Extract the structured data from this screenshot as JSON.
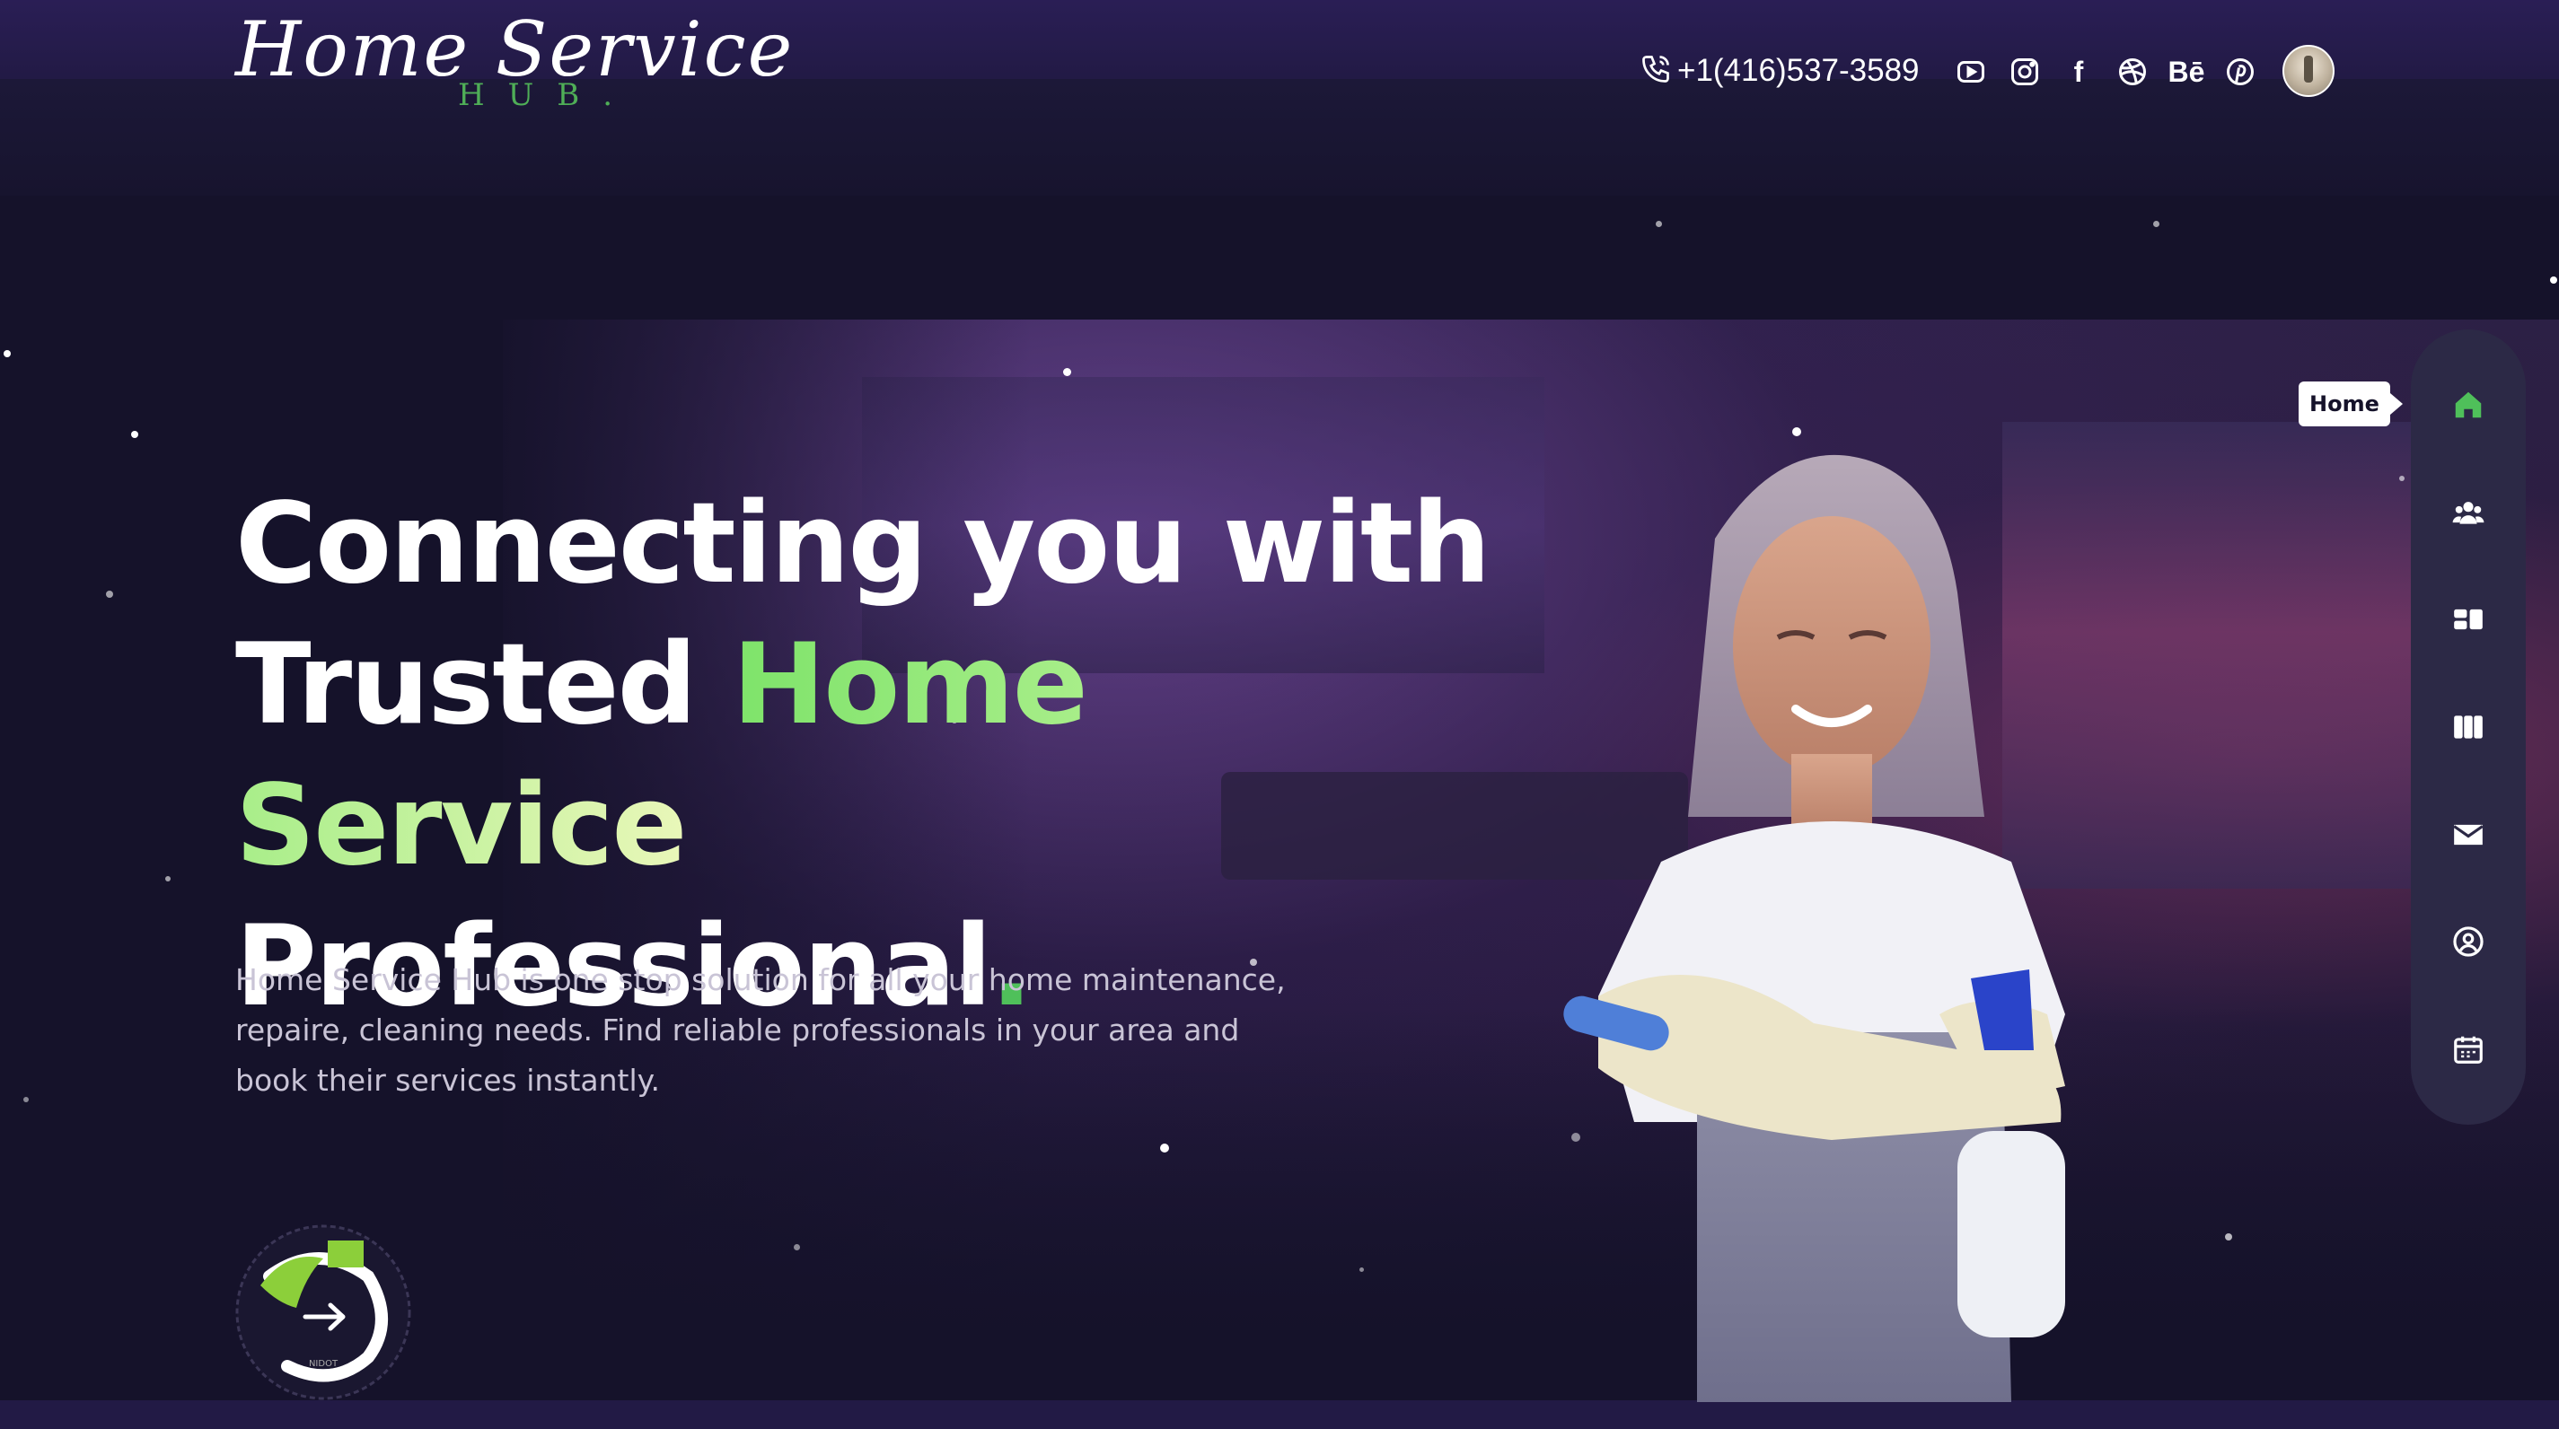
{
  "header": {
    "logo_script": "Home Service",
    "logo_sub": "HUB.",
    "phone": "+1(416)537-3589",
    "socials": [
      {
        "icon": "youtube-icon"
      },
      {
        "icon": "instagram-icon"
      },
      {
        "icon": "facebook-icon",
        "glyph": "f"
      },
      {
        "icon": "dribbble-icon"
      },
      {
        "icon": "behance-icon",
        "glyph": "Bē"
      },
      {
        "icon": "pinterest-icon"
      }
    ]
  },
  "hero": {
    "headline_line1": "Connecting you with",
    "headline_line2_white": "Trusted",
    "headline_line2_green": "Home Service",
    "headline_line3": "Professional",
    "headline_dot": ".",
    "description": "Home Service Hub is one stop solution for all your home maintenance, repaire, cleaning needs. Find reliable professionals in your area and book their services instantly.",
    "badge_text": "NIDOT"
  },
  "side_nav": {
    "tooltip": "Home",
    "active": "home",
    "items": [
      {
        "icon": "home-icon"
      },
      {
        "icon": "users-icon"
      },
      {
        "icon": "services-icon"
      },
      {
        "icon": "columns-icon"
      },
      {
        "icon": "mail-icon"
      },
      {
        "icon": "user-circle-icon"
      },
      {
        "icon": "calendar-icon"
      }
    ]
  },
  "colors": {
    "background": "#15122a",
    "topbar": "#2a1e55",
    "accent_green": "#4fc05a",
    "nav_bg": "#2c2946"
  }
}
